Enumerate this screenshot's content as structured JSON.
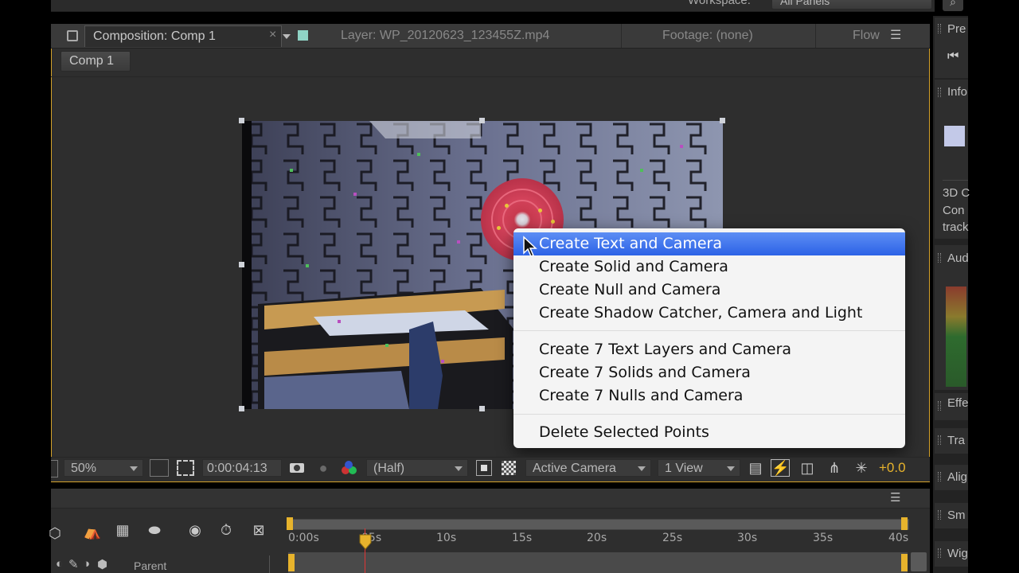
{
  "top": {
    "workspace_label": "Workspace:",
    "workspace_value": "All Panels"
  },
  "tabs": {
    "composition": "Composition: Comp 1",
    "layer": "Layer: WP_20120623_123455Z.mp4",
    "footage": "Footage: (none)",
    "flow": "Flow"
  },
  "breadcrumb": "Comp 1",
  "context_menu": {
    "items": [
      "Create Text and Camera",
      "Create Solid and Camera",
      "Create Null and Camera",
      "Create Shadow Catcher, Camera and Light",
      "Create 7 Text Layers and Camera",
      "Create 7 Solids and Camera",
      "Create 7 Nulls and Camera",
      "Delete Selected Points"
    ]
  },
  "viewer_bar": {
    "zoom": "50%",
    "timecode": "0:00:04:13",
    "resolution": "(Half)",
    "camera": "Active Camera",
    "views": "1 View",
    "exposure": "+0.0"
  },
  "timeline": {
    "ticks": [
      "0:00s",
      "05s",
      "10s",
      "15s",
      "20s",
      "25s",
      "30s",
      "35s",
      "40s"
    ],
    "parent_label": "Parent"
  },
  "right_panels": {
    "preview": "Pre",
    "info": "Info",
    "tracker_lines": [
      "3D C",
      "Con",
      "track"
    ],
    "audio": "Aud",
    "effects": "Effe",
    "tracker": "Tra",
    "align": "Alig",
    "smoother": "Sm",
    "wiggler": "Wig"
  },
  "colors": {
    "accent": "#e7b32c",
    "menu_highlight": "#3c6fe9",
    "panel_bg": "#2e2e2e",
    "tab_bar_bg": "#3a3a3a"
  }
}
